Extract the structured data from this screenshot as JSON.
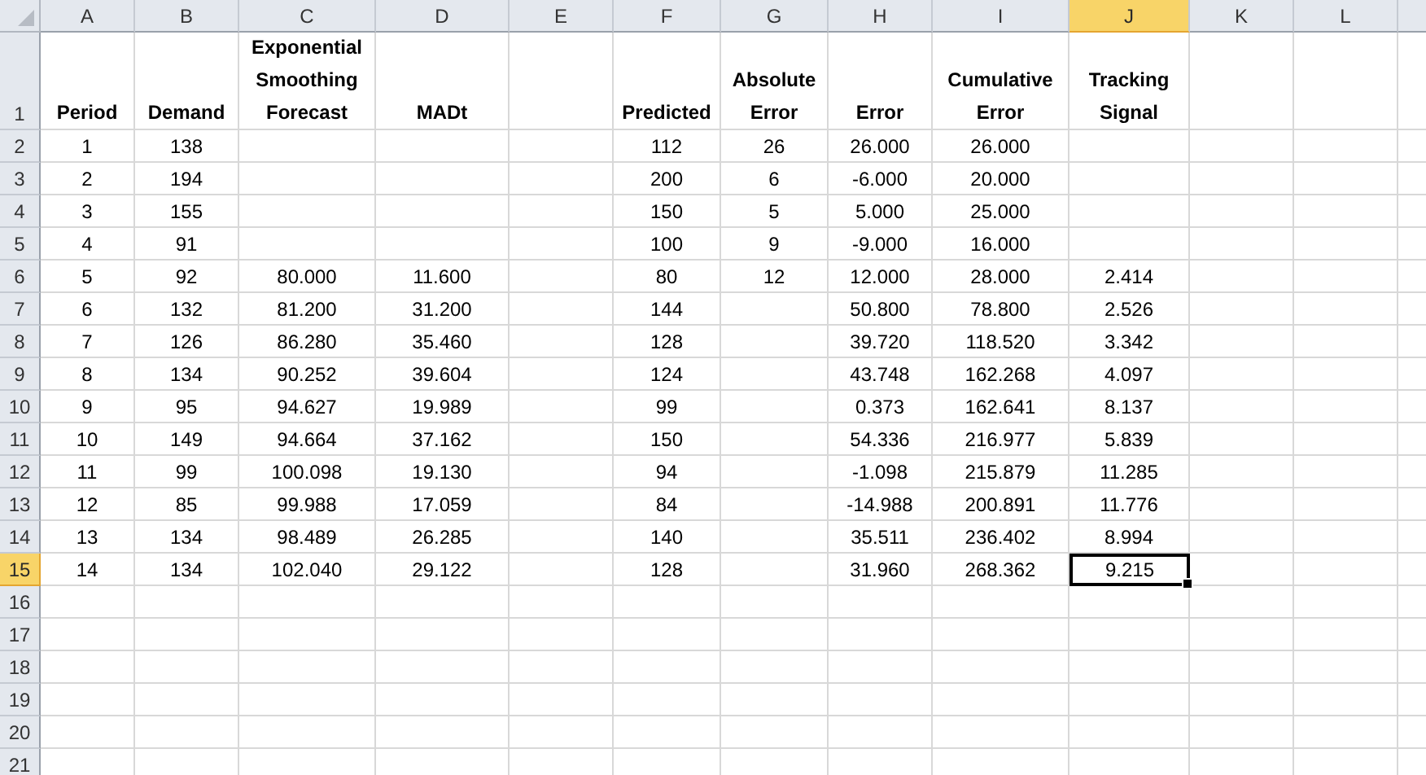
{
  "columns": [
    {
      "letter": "A",
      "selected": false
    },
    {
      "letter": "B",
      "selected": false
    },
    {
      "letter": "C",
      "selected": false
    },
    {
      "letter": "D",
      "selected": false
    },
    {
      "letter": "E",
      "selected": false
    },
    {
      "letter": "F",
      "selected": false
    },
    {
      "letter": "G",
      "selected": false
    },
    {
      "letter": "H",
      "selected": false
    },
    {
      "letter": "I",
      "selected": false
    },
    {
      "letter": "J",
      "selected": true
    },
    {
      "letter": "K",
      "selected": false
    },
    {
      "letter": "L",
      "selected": false
    }
  ],
  "rows": [
    {
      "number": "1",
      "kind": "header",
      "selected": false,
      "cells": {
        "A": "Period",
        "B": "Demand",
        "C": "Exponential Smoothing Forecast",
        "D": "MADt",
        "F": "Predicted",
        "G": "Absolute Error",
        "H": "Error",
        "I": "Cumulative Error",
        "J": "Tracking Signal"
      }
    },
    {
      "number": "2",
      "kind": "data",
      "selected": false,
      "cells": {
        "A": "1",
        "B": "138",
        "F": "112",
        "G": "26",
        "H": "26.000",
        "I": "26.000"
      }
    },
    {
      "number": "3",
      "kind": "data",
      "selected": false,
      "cells": {
        "A": "2",
        "B": "194",
        "F": "200",
        "G": "6",
        "H": "-6.000",
        "I": "20.000"
      }
    },
    {
      "number": "4",
      "kind": "data",
      "selected": false,
      "cells": {
        "A": "3",
        "B": "155",
        "F": "150",
        "G": "5",
        "H": "5.000",
        "I": "25.000"
      }
    },
    {
      "number": "5",
      "kind": "data",
      "selected": false,
      "cells": {
        "A": "4",
        "B": "91",
        "F": "100",
        "G": "9",
        "H": "-9.000",
        "I": "16.000"
      }
    },
    {
      "number": "6",
      "kind": "data",
      "selected": false,
      "cells": {
        "A": "5",
        "B": "92",
        "C": "80.000",
        "D": "11.600",
        "F": "80",
        "G": "12",
        "H": "12.000",
        "I": "28.000",
        "J": "2.414"
      }
    },
    {
      "number": "7",
      "kind": "data",
      "selected": false,
      "cells": {
        "A": "6",
        "B": "132",
        "C": "81.200",
        "D": "31.200",
        "F": "144",
        "H": "50.800",
        "I": "78.800",
        "J": "2.526"
      }
    },
    {
      "number": "8",
      "kind": "data",
      "selected": false,
      "cells": {
        "A": "7",
        "B": "126",
        "C": "86.280",
        "D": "35.460",
        "F": "128",
        "H": "39.720",
        "I": "118.520",
        "J": "3.342"
      }
    },
    {
      "number": "9",
      "kind": "data",
      "selected": false,
      "cells": {
        "A": "8",
        "B": "134",
        "C": "90.252",
        "D": "39.604",
        "F": "124",
        "H": "43.748",
        "I": "162.268",
        "J": "4.097"
      }
    },
    {
      "number": "10",
      "kind": "data",
      "selected": false,
      "cells": {
        "A": "9",
        "B": "95",
        "C": "94.627",
        "D": "19.989",
        "F": "99",
        "H": "0.373",
        "I": "162.641",
        "J": "8.137"
      }
    },
    {
      "number": "11",
      "kind": "data",
      "selected": false,
      "cells": {
        "A": "10",
        "B": "149",
        "C": "94.664",
        "D": "37.162",
        "F": "150",
        "H": "54.336",
        "I": "216.977",
        "J": "5.839"
      }
    },
    {
      "number": "12",
      "kind": "data",
      "selected": false,
      "cells": {
        "A": "11",
        "B": "99",
        "C": "100.098",
        "D": "19.130",
        "F": "94",
        "H": "-1.098",
        "I": "215.879",
        "J": "11.285"
      }
    },
    {
      "number": "13",
      "kind": "data",
      "selected": false,
      "cells": {
        "A": "12",
        "B": "85",
        "C": "99.988",
        "D": "17.059",
        "F": "84",
        "H": "-14.988",
        "I": "200.891",
        "J": "11.776"
      }
    },
    {
      "number": "14",
      "kind": "data",
      "selected": false,
      "cells": {
        "A": "13",
        "B": "134",
        "C": "98.489",
        "D": "26.285",
        "F": "140",
        "H": "35.511",
        "I": "236.402",
        "J": "8.994"
      }
    },
    {
      "number": "15",
      "kind": "data",
      "selected": true,
      "cells": {
        "A": "14",
        "B": "134",
        "C": "102.040",
        "D": "29.122",
        "F": "128",
        "H": "31.960",
        "I": "268.362",
        "J": "9.215"
      }
    },
    {
      "number": "16",
      "kind": "data",
      "selected": false,
      "cells": {}
    },
    {
      "number": "17",
      "kind": "data",
      "selected": false,
      "cells": {}
    },
    {
      "number": "18",
      "kind": "data",
      "selected": false,
      "cells": {}
    },
    {
      "number": "19",
      "kind": "data",
      "selected": false,
      "cells": {}
    },
    {
      "number": "20",
      "kind": "data",
      "selected": false,
      "cells": {}
    },
    {
      "number": "21",
      "kind": "data",
      "selected": false,
      "cells": {}
    }
  ]
}
